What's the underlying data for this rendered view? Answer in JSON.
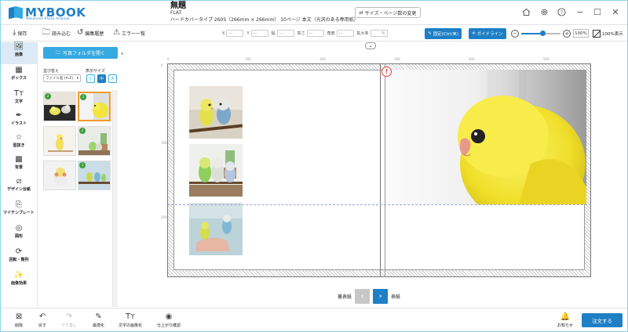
{
  "app": {
    "logo_text": "MYBOOK",
    "logo_sub": "Advanced Photo Artbook"
  },
  "document": {
    "title": "無題",
    "subtitle": "FLAT",
    "line": "ハードカバータイプ 260S（266mm × 266mm） 10ページ 本文（光沢のある専用紙）",
    "size_change_label": "サイズ・ページ数の変更"
  },
  "window_controls": {
    "home": "home-icon",
    "settings": "gear-icon",
    "help": "?",
    "minimize": "−",
    "maximize": "☐",
    "close": "✕"
  },
  "toolbar": {
    "save": "保存",
    "load": "読み込む",
    "history": "編集履歴",
    "errors": "エラー一覧",
    "props": [
      {
        "label": "X",
        "value": "—"
      },
      {
        "label": "Y",
        "value": "—"
      },
      {
        "label": "幅",
        "value": "—"
      },
      {
        "label": "高さ",
        "value": "—"
      },
      {
        "label": "角度",
        "value": "—"
      },
      {
        "label": "拡大率",
        "value": "%"
      }
    ],
    "fixed_label": "固定(Ctrl/⌘)",
    "guide_label": "ガイドライン",
    "zoom_value": "100%",
    "zoom_level": 0.55,
    "show100_label": "100%表示"
  },
  "sidebar": {
    "items": [
      {
        "icon": "image-icon",
        "label": "画像"
      },
      {
        "icon": "box-icon",
        "label": "ボックス"
      },
      {
        "icon": "text-icon",
        "label": "文字"
      },
      {
        "icon": "pen-icon",
        "label": "イラスト"
      },
      {
        "icon": "star-icon",
        "label": "型抜き"
      },
      {
        "icon": "checker-icon",
        "label": "背景"
      },
      {
        "icon": "layout-icon",
        "label": "デザイン台紙"
      },
      {
        "icon": "template-icon",
        "label": "マイテンプレート"
      },
      {
        "icon": "shape-icon",
        "label": "図形"
      },
      {
        "icon": "rotate-icon",
        "label": "回転・整列"
      },
      {
        "icon": "effect-icon",
        "label": "画像効果"
      }
    ]
  },
  "panel": {
    "folder_button": "写真フォルダを開く",
    "sort_label": "並び替え",
    "sort_value": "ファイル名 (A-Z)",
    "display_size_label": "表示サイズ",
    "size_options": [
      "小",
      "中",
      "大"
    ],
    "selected_size": "中",
    "thumbnails": [
      {
        "num": "2"
      },
      {
        "num": "1"
      },
      {
        "num": ""
      },
      {
        "num": "2"
      },
      {
        "num": ""
      },
      {
        "num": "1"
      }
    ]
  },
  "canvas": {
    "ruler_top": [
      "0",
      "100",
      "200",
      "300",
      "400",
      "500"
    ],
    "ruler_left": [
      "0",
      "100",
      "200"
    ],
    "warning_icon": "!",
    "nav_back": "裏表紙",
    "nav_front": "表紙"
  },
  "bottombar": {
    "delete": "削除",
    "undo": "戻す",
    "redo": "やり直し",
    "optimize": "最適化",
    "text_image": "文字の画像化",
    "preview": "仕上がり確認",
    "notice": "お知らせ",
    "order": "注文する"
  },
  "colors": {
    "accent": "#1f7fc4",
    "accent_light": "#36a9e1",
    "warning": "#e23b3b",
    "selected_thumb": "#f19b2c"
  }
}
